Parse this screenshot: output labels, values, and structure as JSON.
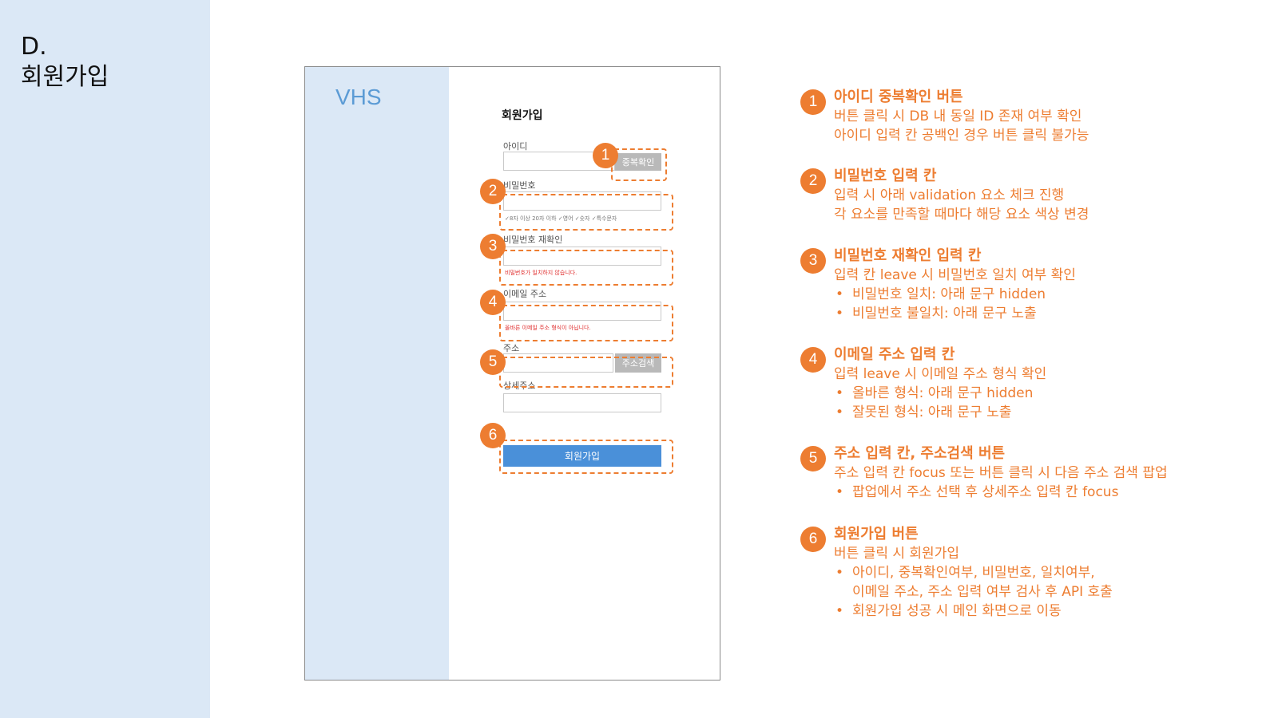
{
  "slide": {
    "title_line1": "D.",
    "title_line2": "회원가입"
  },
  "mock": {
    "logo": "VHS",
    "form_title": "회원가입",
    "id_label": "아이디",
    "dup_check_button": "중복확인",
    "password_label": "비밀번호",
    "password_hint": "✓8자 이상 20자 이하 ✓영어 ✓숫자 ✓특수문자",
    "password_confirm_label": "비밀번호 재확인",
    "password_mismatch_error": "비밀번호가 일치하지 않습니다.",
    "email_label": "이메일 주소",
    "email_error": "올바른 이메일 주소 형식이 아닙니다.",
    "address_label": "주소",
    "address_search_button": "주소검색",
    "detail_address_label": "상세주소",
    "submit_button": "회원가입"
  },
  "markers": [
    "1",
    "2",
    "3",
    "4",
    "5",
    "6"
  ],
  "notes": [
    {
      "num": "1",
      "title": "아이디 중복확인 버튼",
      "lines": [
        "버튼 클릭 시 DB 내 동일 ID 존재 여부 확인",
        "아이디 입력 칸 공백인 경우 버튼 클릭 불가능"
      ]
    },
    {
      "num": "2",
      "title": "비밀번호 입력 칸",
      "lines": [
        "입력 시 아래 validation 요소 체크 진행",
        "각 요소를 만족할 때마다 해당 요소 색상 변경"
      ]
    },
    {
      "num": "3",
      "title": "비밀번호 재확인 입력 칸",
      "lines": [
        "입력 칸 leave 시 비밀번호 일치 여부 확인"
      ],
      "bullets": [
        "비밀번호 일치: 아래 문구 hidden",
        "비밀번호 불일치: 아래 문구 노출"
      ]
    },
    {
      "num": "4",
      "title": "이메일 주소 입력 칸",
      "lines": [
        "입력 leave 시 이메일 주소 형식 확인"
      ],
      "bullets": [
        "올바른 형식: 아래 문구 hidden",
        "잘못된 형식: 아래 문구 노출"
      ]
    },
    {
      "num": "5",
      "title": "주소 입력 칸, 주소검색 버튼",
      "lines": [
        "주소 입력 칸 focus 또는 버튼 클릭 시 다음 주소 검색 팝업"
      ],
      "bullets": [
        "팝업에서 주소 선택 후 상세주소 입력 칸 focus"
      ]
    },
    {
      "num": "6",
      "title": "회원가입 버튼",
      "lines": [
        "버튼 클릭 시 회원가입"
      ],
      "bullets": [
        "아이디, 중복확인여부, 비밀번호, 일치여부,",
        "회원가입 성공 시 메인 화면으로 이동"
      ],
      "bullet_continuation": "이메일 주소, 주소 입력 여부 검사 후 API 호출"
    }
  ]
}
